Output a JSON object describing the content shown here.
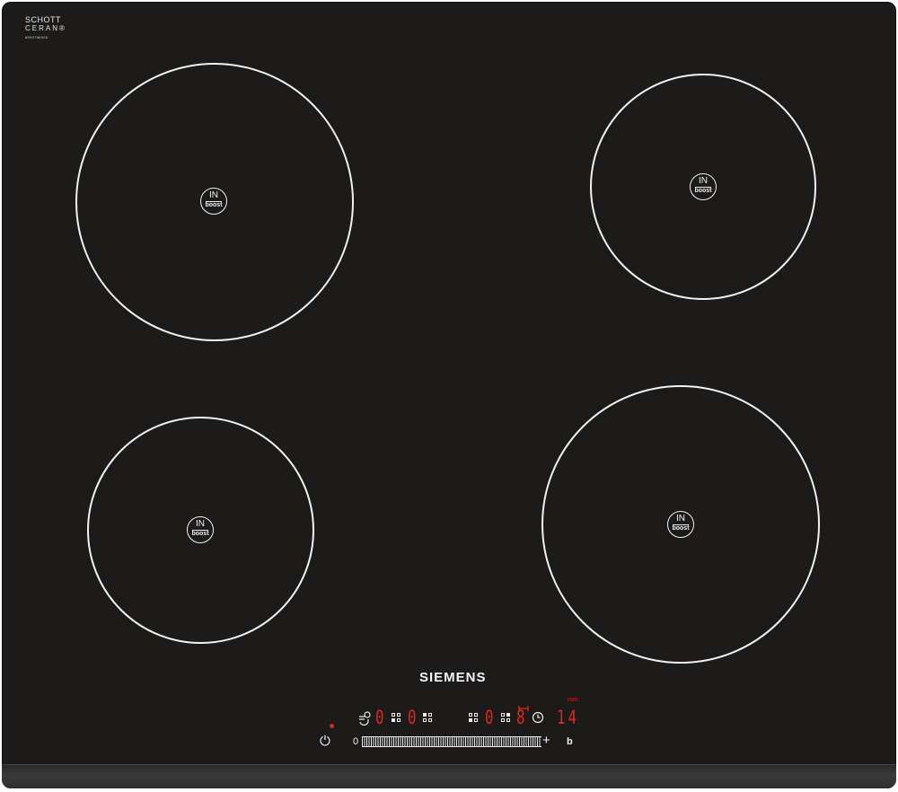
{
  "brand_logo": {
    "line1": "SCHOTT",
    "line2": "CERAN®",
    "code": "8000786926"
  },
  "cooking_zones": [
    {
      "position": "rear-left",
      "badge_top": "IN",
      "badge_bottom": "boost"
    },
    {
      "position": "rear-right",
      "badge_top": "IN",
      "badge_bottom": "boost"
    },
    {
      "position": "front-left",
      "badge_top": "IN",
      "badge_bottom": "boost"
    },
    {
      "position": "front-right",
      "badge_top": "IN",
      "badge_bottom": "boost"
    }
  ],
  "manufacturer": "SIEMENS",
  "control_panel": {
    "zone_levels": [
      "0",
      "0",
      "0",
      "8"
    ],
    "timer_value": "14",
    "timer_unit": "min",
    "slider_min_label": "0",
    "slider_plus_label": "+",
    "boost_label": "b",
    "power_symbol": "⏻",
    "indicator_color": "#e0261e",
    "icons": [
      "power-icon",
      "wipe-protect-icon",
      "zone-select-icon",
      "timer-clock-icon",
      "pan-icon"
    ]
  }
}
